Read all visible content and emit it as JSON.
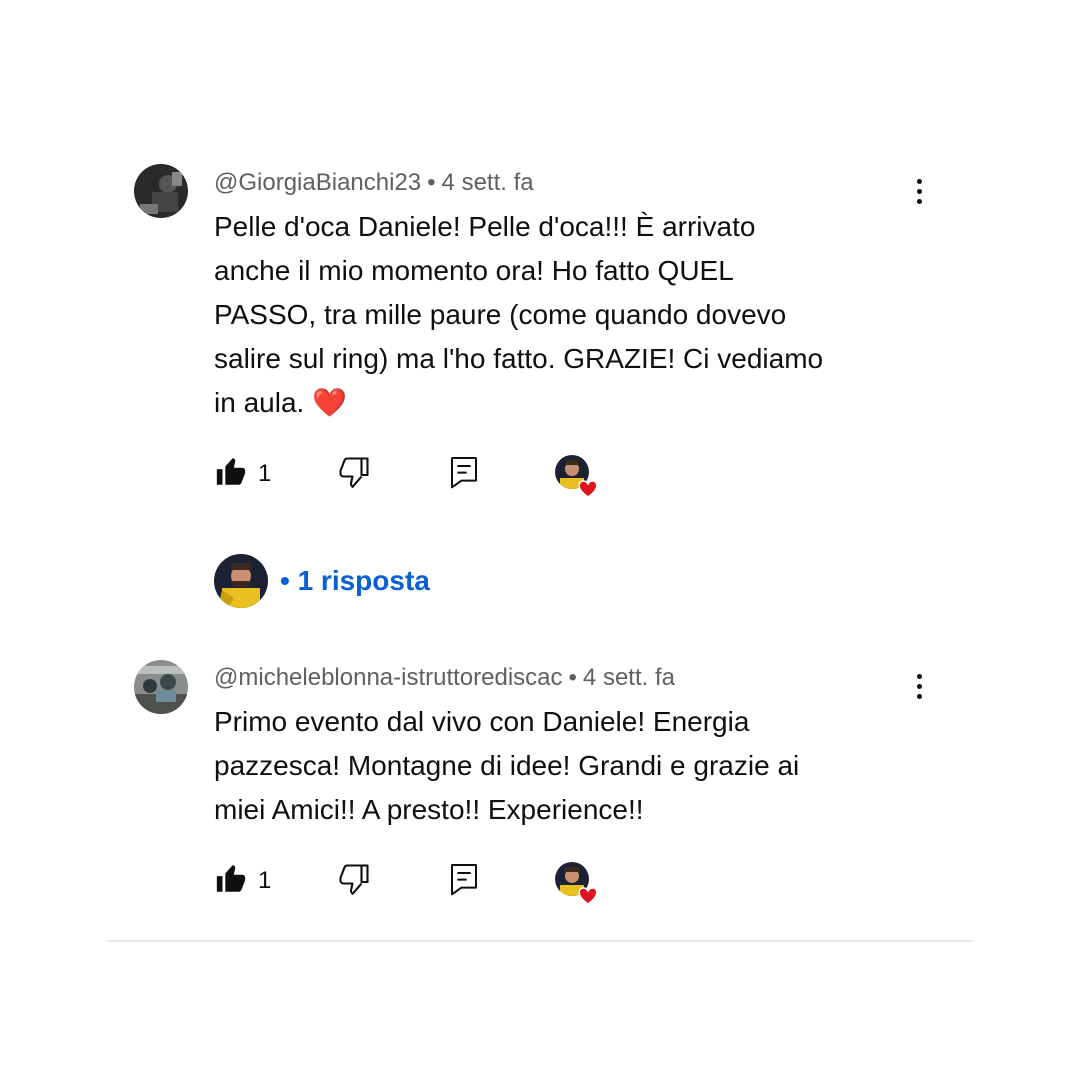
{
  "comments": [
    {
      "author": "@GiorgiaBianchi23",
      "separator": "•",
      "time": "4 sett. fa",
      "text": "Pelle d'oca Daniele! Pelle d'oca!!! È arrivato\nanche il mio momento ora! Ho fatto QUEL\nPASSO, tra mille paure (come quando dovevo\nsalire sul ring) ma l'ho fatto. GRAZIE! Ci vediamo\nin aula. ❤️",
      "likes": "1",
      "hearted_by_creator": true
    },
    {
      "author": "@micheleblonna-istruttorediscac",
      "separator": "•",
      "time": "4 sett. fa",
      "text": "Primo evento dal vivo con Daniele! Energia\npazzesca! Montagne di idee! Grandi e grazie ai\nmiei Amici!! A presto!! Experience!!",
      "likes": "1",
      "hearted_by_creator": true
    }
  ],
  "replies": {
    "label": "• 1 risposta"
  },
  "icons": {
    "like": "thumbs-up-filled-icon",
    "dislike": "thumbs-down-outline-icon",
    "reply": "comment-reply-icon",
    "more": "vertical-dots-icon",
    "heart": "creator-heart-icon"
  },
  "colors": {
    "link_blue": "#065fd4",
    "meta_gray": "#606060",
    "heart_red": "#e0141e"
  }
}
